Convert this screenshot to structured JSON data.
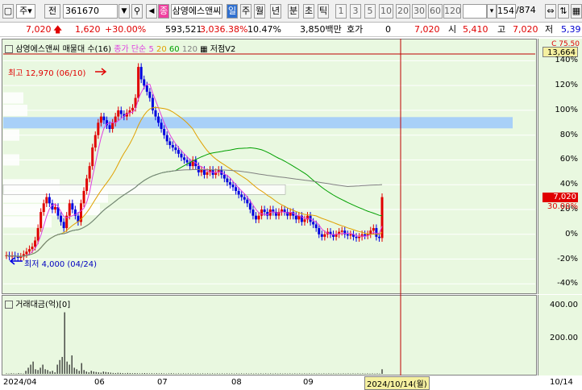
{
  "toolbar": {
    "period_label": "주",
    "prev_label": "전",
    "code": "361670",
    "stock_badge": "종",
    "stock_name": "삼영에스앤씨",
    "tabs": [
      "일",
      "주",
      "월",
      "년",
      "분",
      "초",
      "틱"
    ],
    "intervals": [
      "1",
      "3",
      "5",
      "10",
      "20",
      "30",
      "60",
      "120"
    ],
    "count": "154",
    "total": "/874"
  },
  "info": {
    "price": "7,020",
    "change": "1,620",
    "change_pct": "+30.00%",
    "volume": "593,521",
    "volume_pct": "3,036.38%",
    "turnover": "10.47%",
    "amount": "3,850백만",
    "quote_label": "호가",
    "quote_value": "0",
    "bid": "7,020",
    "open_label": "시",
    "open": "5,410",
    "high_label": "고",
    "high": "7,020",
    "low_label": "저",
    "low": "5,39"
  },
  "price_legend": {
    "title": "삼영에스앤씨 매물대 수(16)",
    "ma_label": "종가 단순",
    "ma_periods": [
      "5",
      "20",
      "60",
      "120"
    ],
    "ma_colors": [
      "#e040e0",
      "#e0a000",
      "#00a000",
      "#808080"
    ],
    "indicator": "저점V2"
  },
  "volume_legend": {
    "title": "거래대금(억)[0]"
  },
  "annotations": {
    "high_text": "최고 12,970 (06/10)",
    "low_text": "최저 4,000 (04/24)"
  },
  "right_axis": {
    "top_value": "13,664",
    "top_partial": "C 75.50",
    "current_price": "7,020",
    "current_pct": "30.00%",
    "price_ticks": [
      "140%",
      "120%",
      "100%",
      "80%",
      "60%",
      "40%",
      "20%",
      "0%",
      "-20%",
      "-40%"
    ],
    "volume_ticks": [
      "400.00",
      "200.00"
    ]
  },
  "x_axis": {
    "labels": [
      "2024/04",
      "06",
      "07",
      "08",
      "09"
    ],
    "cursor_label": "2024/10/14(월)",
    "right_label": "10/14"
  },
  "chart_data": {
    "type": "candlestick",
    "closes_pct": [
      -17,
      -18,
      -17,
      -18,
      -19,
      -18,
      -16,
      -14,
      -12,
      -10,
      -5,
      5,
      18,
      25,
      30,
      25,
      20,
      22,
      15,
      10,
      5,
      15,
      25,
      20,
      15,
      10,
      25,
      35,
      45,
      55,
      70,
      80,
      90,
      95,
      92,
      88,
      85,
      90,
      95,
      100,
      97,
      95,
      98,
      100,
      102,
      110,
      135,
      125,
      120,
      115,
      110,
      100,
      95,
      90,
      85,
      80,
      75,
      72,
      70,
      68,
      65,
      62,
      60,
      58,
      55,
      60,
      55,
      50,
      52,
      48,
      50,
      52,
      48,
      50,
      52,
      48,
      45,
      42,
      40,
      38,
      35,
      32,
      30,
      28,
      25,
      20,
      15,
      12,
      15,
      20,
      18,
      15,
      20,
      18,
      15,
      18,
      20,
      18,
      15,
      18,
      15,
      12,
      15,
      10,
      12,
      15,
      10,
      8,
      5,
      0,
      -2,
      0,
      2,
      0,
      -2,
      0,
      2,
      3,
      0,
      -1,
      0,
      -2,
      -3,
      -2,
      0,
      -1,
      0,
      3,
      5,
      -2,
      -3,
      30
    ],
    "volumes": [
      3,
      2,
      4,
      3,
      2,
      5,
      3,
      2,
      20,
      40,
      60,
      80,
      30,
      25,
      40,
      60,
      30,
      25,
      15,
      20,
      10,
      60,
      90,
      110,
      400,
      80,
      60,
      120,
      40,
      30,
      20,
      70,
      25,
      15,
      10,
      20,
      15,
      12,
      10,
      8,
      15,
      12,
      10,
      8,
      6,
      5,
      7,
      6,
      5,
      4,
      6,
      5,
      4,
      5,
      4,
      3,
      4,
      5,
      4,
      3,
      4,
      3,
      4,
      3,
      4,
      3,
      2,
      3,
      4,
      3,
      2,
      3,
      2,
      3,
      2,
      3,
      2,
      3,
      2,
      3,
      2,
      3,
      2,
      3,
      2,
      3,
      2,
      3,
      2,
      3,
      2,
      3,
      2,
      3,
      2,
      3,
      2,
      3,
      2,
      3,
      2,
      3,
      2,
      3,
      2,
      3,
      2,
      3,
      2,
      3,
      2,
      3,
      2,
      3,
      2,
      3,
      2,
      3,
      2,
      3,
      2,
      3,
      2,
      3,
      2,
      3,
      2,
      3,
      2,
      3,
      2,
      3,
      2,
      3,
      2,
      3,
      2,
      3,
      2,
      3,
      2,
      3,
      2,
      3,
      2,
      3,
      2,
      3,
      2,
      3,
      2,
      3,
      2,
      3,
      2,
      30
    ],
    "ylim_pct": [
      -45,
      150
    ],
    "volume_ylim": [
      0,
      450
    ],
    "grid": true
  },
  "colors": {
    "up": "#e00000",
    "down": "#0000e0",
    "pane_bg": "#e9f8e0",
    "band": "#a8d0f8"
  }
}
